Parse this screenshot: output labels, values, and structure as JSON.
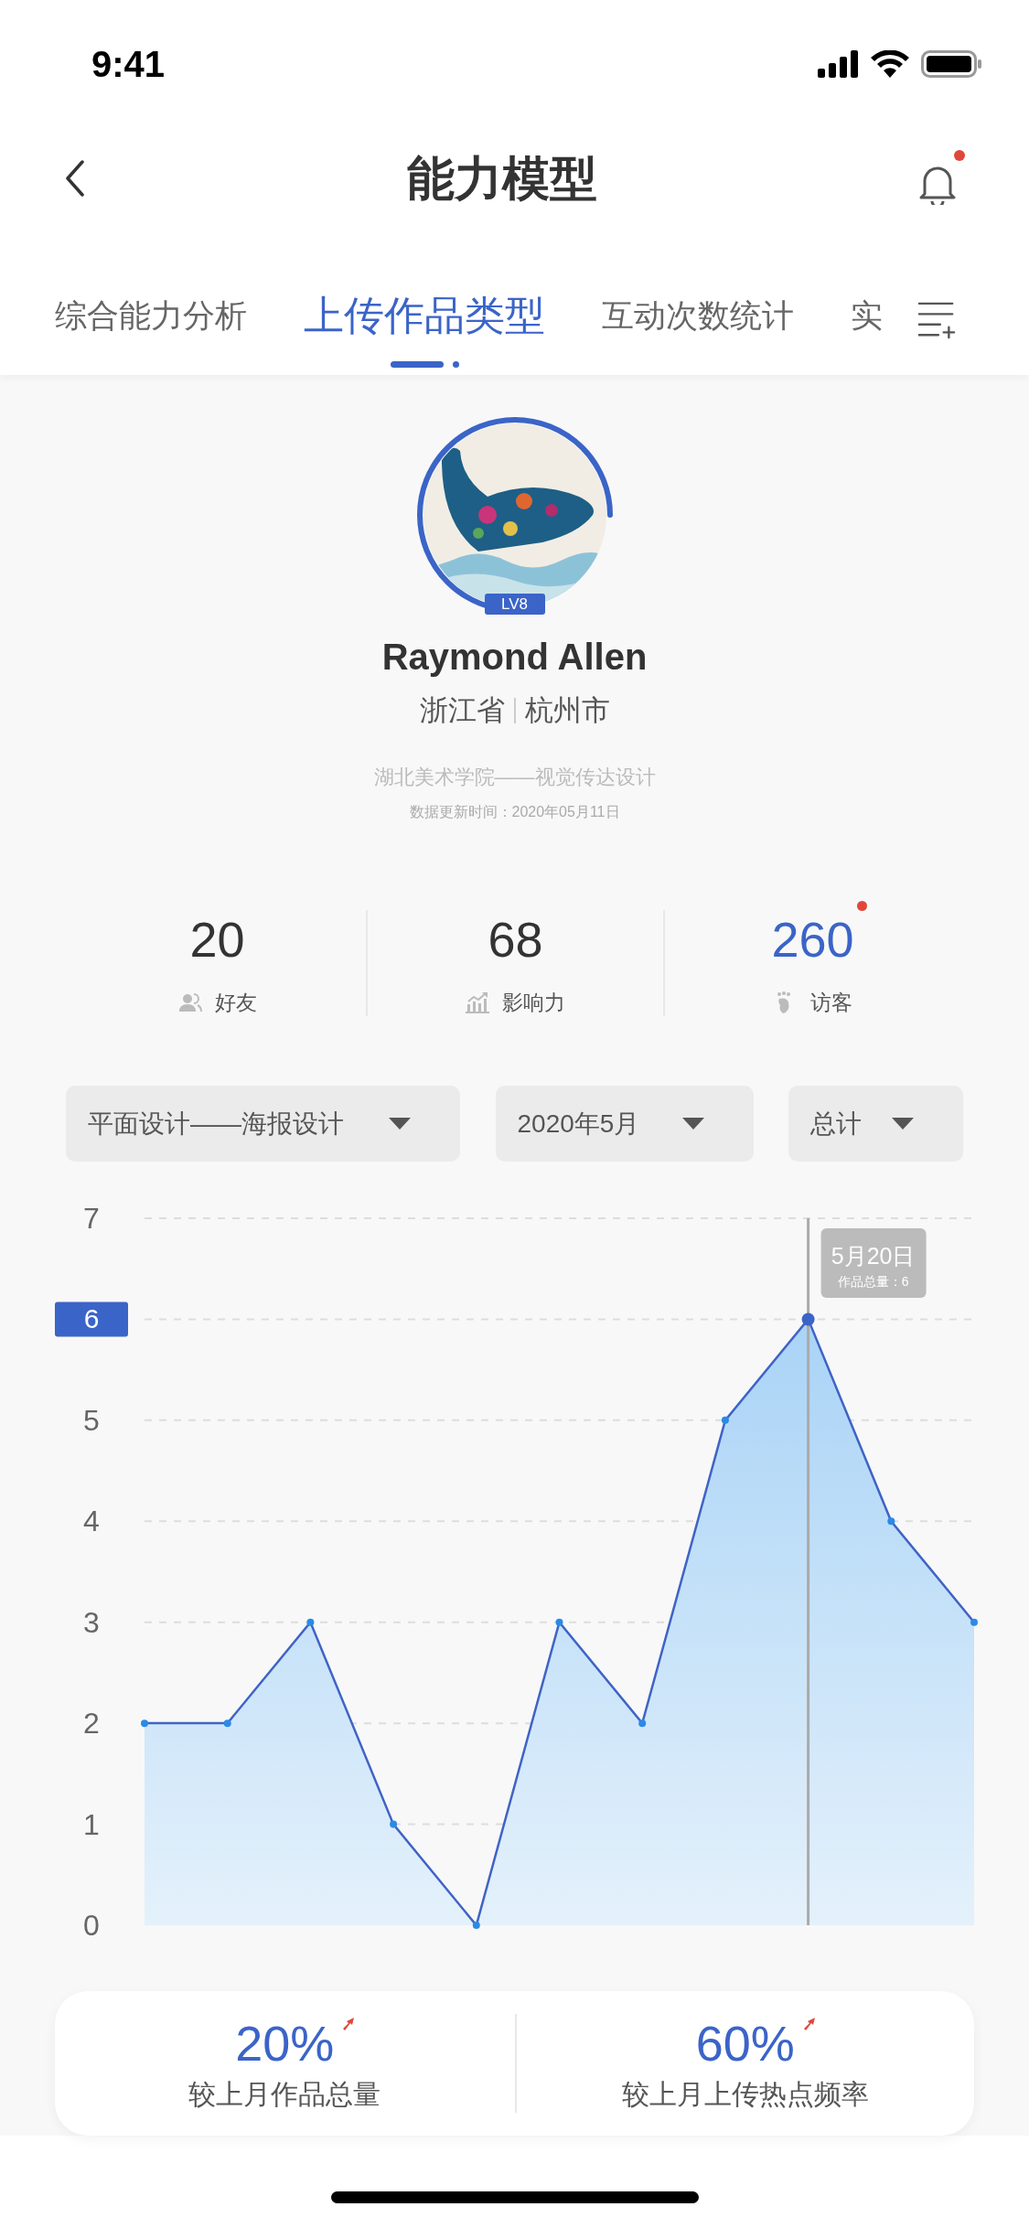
{
  "status_bar": {
    "time": "9:41"
  },
  "nav": {
    "title": "能力模型",
    "notifications_unread": true
  },
  "tabs": [
    {
      "label": "综合能力分析",
      "selected": false
    },
    {
      "label": "上传作品类型",
      "selected": true
    },
    {
      "label": "互动次数统计",
      "selected": false
    },
    {
      "label": "实",
      "selected": false
    }
  ],
  "profile": {
    "badge": "LV8",
    "name": "Raymond Allen",
    "province": "浙江省",
    "city": "杭州市",
    "school": "湖北美术学院——视觉传达设计",
    "updated": "数据更新时间：2020年05月11日"
  },
  "stats": [
    {
      "kind": "friends",
      "value": "20",
      "label": "好友",
      "highlight": false,
      "unread": false
    },
    {
      "kind": "influence",
      "value": "68",
      "label": "影响力",
      "highlight": false,
      "unread": false
    },
    {
      "kind": "visitors",
      "value": "260",
      "label": "访客",
      "highlight": true,
      "unread": true
    }
  ],
  "filters": [
    {
      "label": "平面设计——海报设计"
    },
    {
      "label": "2020年5月"
    },
    {
      "label": "总计"
    }
  ],
  "chart": {
    "marker_label": "6",
    "tooltip": {
      "title": "5月20日",
      "text": "作品总量：6"
    },
    "chart_data": {
      "type": "area",
      "values": [
        2,
        2,
        3,
        1,
        0,
        3,
        2,
        5,
        6,
        4,
        3
      ],
      "ylim": [
        0,
        7
      ],
      "yticks": [
        0,
        1,
        2,
        3,
        4,
        5,
        6,
        7
      ],
      "grid": true
    }
  },
  "summary": [
    {
      "value": "20%",
      "label": "较上月作品总量"
    },
    {
      "value": "60%",
      "label": "较上月上传热点频率"
    }
  ]
}
